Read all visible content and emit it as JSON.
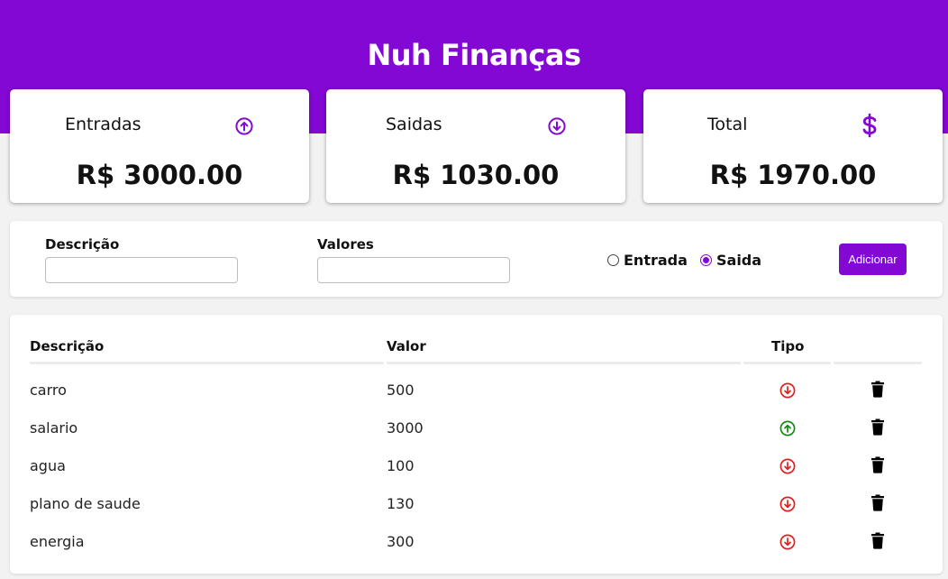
{
  "app": {
    "title": "Nuh Finanças"
  },
  "colors": {
    "brand": "#8308d3",
    "income": "#138a13",
    "expense": "#e02020"
  },
  "summary": {
    "entradas": {
      "label": "Entradas",
      "value": "R$ 3000.00",
      "icon": "arrow-up-circle-icon"
    },
    "saidas": {
      "label": "Saidas",
      "value": "R$ 1030.00",
      "icon": "arrow-down-circle-icon"
    },
    "total": {
      "label": "Total",
      "value": "R$ 1970.00",
      "icon": "dollar-icon"
    }
  },
  "form": {
    "descricao_label": "Descrição",
    "descricao_value": "",
    "valores_label": "Valores",
    "valores_value": "",
    "tipo_options": [
      {
        "label": "Entrada",
        "checked": false
      },
      {
        "label": "Saida",
        "checked": true
      }
    ],
    "submit_label": "Adicionar"
  },
  "table": {
    "headers": {
      "descricao": "Descrição",
      "valor": "Valor",
      "tipo": "Tipo"
    },
    "rows": [
      {
        "descricao": "carro",
        "valor": "500",
        "tipo": "saida"
      },
      {
        "descricao": "salario",
        "valor": "3000",
        "tipo": "entrada"
      },
      {
        "descricao": "agua",
        "valor": "100",
        "tipo": "saida"
      },
      {
        "descricao": "plano de saude",
        "valor": "130",
        "tipo": "saida"
      },
      {
        "descricao": "energia",
        "valor": "300",
        "tipo": "saida"
      }
    ]
  }
}
